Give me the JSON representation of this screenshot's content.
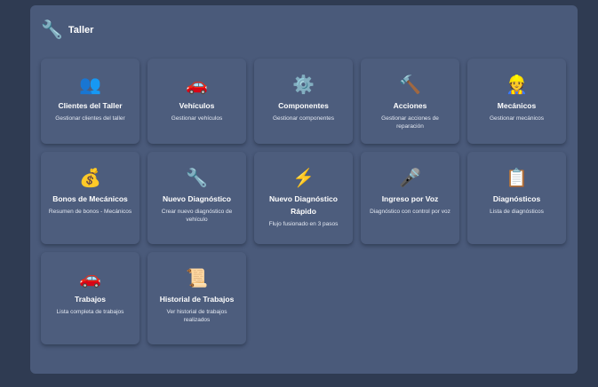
{
  "header": {
    "icon": "wrench-icon",
    "title": "Taller"
  },
  "cards": [
    {
      "icon": "👥",
      "icon_name": "people-icon",
      "label": "Clientes del Taller",
      "desc": "Gestionar clientes del taller"
    },
    {
      "icon": "🚗",
      "icon_name": "car-icon",
      "label": "Vehículos",
      "desc": "Gestionar vehículos"
    },
    {
      "icon": "⚙️",
      "icon_name": "gear-icon",
      "label": "Componentes",
      "desc": "Gestionar componentes"
    },
    {
      "icon": "🔨",
      "icon_name": "hammer-icon",
      "label": "Acciones",
      "desc": "Gestionar acciones de reparación"
    },
    {
      "icon": "👷",
      "icon_name": "mechanic-icon",
      "label": "Mecánicos",
      "desc": "Gestionar mecánicos"
    },
    {
      "icon": "💰",
      "icon_name": "money-bag-icon",
      "label": "Bonos de Mecánicos",
      "desc": "Resumen de bonos - Mecánicos"
    },
    {
      "icon": "🔧",
      "icon_name": "wrench-icon",
      "label": "Nuevo Diagnóstico",
      "desc": "Crear nuevo diagnóstico de vehículo"
    },
    {
      "icon": "⚡",
      "icon_name": "lightning-icon",
      "label": "Nuevo Diagnóstico Rápido",
      "desc": "Flujo fusionado en 3 pasos"
    },
    {
      "icon": "🎤",
      "icon_name": "microphone-icon",
      "label": "Ingreso por Voz",
      "desc": "Diagnóstico con control por voz"
    },
    {
      "icon": "📋",
      "icon_name": "clipboard-icon",
      "label": "Diagnósticos",
      "desc": "Lista de diagnósticos"
    },
    {
      "icon": "🚗",
      "icon_name": "car-icon",
      "label": "Trabajos",
      "desc": "Lista completa de trabajos"
    },
    {
      "icon": "📜",
      "icon_name": "scroll-icon",
      "label": "Historial de Trabajos",
      "desc": "Ver historial de trabajos realizados"
    }
  ]
}
